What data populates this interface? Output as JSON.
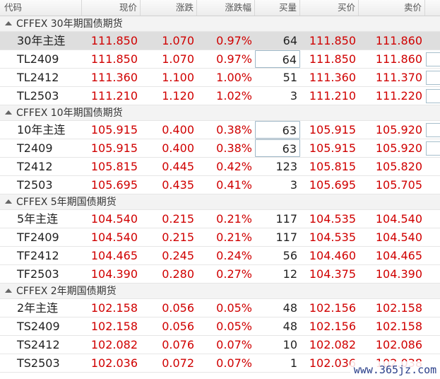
{
  "columns": [
    "代码",
    "现价",
    "涨跌",
    "涨跌幅",
    "买量",
    "买价",
    "卖价"
  ],
  "groups": [
    {
      "label": "CFFEX 30年期国债期货",
      "rows": [
        {
          "code": "30年主连",
          "price": "111.850",
          "change": "1.070",
          "pct": "0.97%",
          "bid_vol": "64",
          "bid": "111.850",
          "ask": "111.860",
          "selected": true
        },
        {
          "code": "TL2409",
          "price": "111.850",
          "change": "1.070",
          "pct": "0.97%",
          "bid_vol": "64",
          "bid": "111.850",
          "ask": "111.860",
          "bidvol_box": true,
          "edge_box": true
        },
        {
          "code": "TL2412",
          "price": "111.360",
          "change": "1.100",
          "pct": "1.00%",
          "bid_vol": "51",
          "bid": "111.360",
          "ask": "111.370",
          "edge_box": true
        },
        {
          "code": "TL2503",
          "price": "111.210",
          "change": "1.120",
          "pct": "1.02%",
          "bid_vol": "3",
          "bid": "111.210",
          "ask": "111.220",
          "edge_box": true
        }
      ]
    },
    {
      "label": "CFFEX 10年期国债期货",
      "rows": [
        {
          "code": "10年主连",
          "price": "105.915",
          "change": "0.400",
          "pct": "0.38%",
          "bid_vol": "63",
          "bid": "105.915",
          "ask": "105.920",
          "bidvol_box": true,
          "edge_box": true
        },
        {
          "code": "T2409",
          "price": "105.915",
          "change": "0.400",
          "pct": "0.38%",
          "bid_vol": "63",
          "bid": "105.915",
          "ask": "105.920",
          "bidvol_box": true,
          "edge_box": true
        },
        {
          "code": "T2412",
          "price": "105.815",
          "change": "0.445",
          "pct": "0.42%",
          "bid_vol": "123",
          "bid": "105.815",
          "ask": "105.820"
        },
        {
          "code": "T2503",
          "price": "105.695",
          "change": "0.435",
          "pct": "0.41%",
          "bid_vol": "3",
          "bid": "105.695",
          "ask": "105.705"
        }
      ]
    },
    {
      "label": "CFFEX 5年期国债期货",
      "rows": [
        {
          "code": "5年主连",
          "price": "104.540",
          "change": "0.215",
          "pct": "0.21%",
          "bid_vol": "117",
          "bid": "104.535",
          "ask": "104.540"
        },
        {
          "code": "TF2409",
          "price": "104.540",
          "change": "0.215",
          "pct": "0.21%",
          "bid_vol": "117",
          "bid": "104.535",
          "ask": "104.540"
        },
        {
          "code": "TF2412",
          "price": "104.465",
          "change": "0.245",
          "pct": "0.24%",
          "bid_vol": "56",
          "bid": "104.460",
          "ask": "104.465"
        },
        {
          "code": "TF2503",
          "price": "104.390",
          "change": "0.280",
          "pct": "0.27%",
          "bid_vol": "12",
          "bid": "104.375",
          "ask": "104.390"
        }
      ]
    },
    {
      "label": "CFFEX 2年期国债期货",
      "rows": [
        {
          "code": "2年主连",
          "price": "102.158",
          "change": "0.056",
          "pct": "0.05%",
          "bid_vol": "48",
          "bid": "102.156",
          "ask": "102.158"
        },
        {
          "code": "TS2409",
          "price": "102.158",
          "change": "0.056",
          "pct": "0.05%",
          "bid_vol": "48",
          "bid": "102.156",
          "ask": "102.158"
        },
        {
          "code": "TS2412",
          "price": "102.082",
          "change": "0.076",
          "pct": "0.07%",
          "bid_vol": "10",
          "bid": "102.082",
          "ask": "102.086"
        },
        {
          "code": "TS2503",
          "price": "102.036",
          "change": "0.072",
          "pct": "0.07%",
          "bid_vol": "1",
          "bid": "102.036",
          "ask": "102.038"
        }
      ]
    }
  ],
  "watermark": "www.365jz.com",
  "colors": {
    "up": "#d00000",
    "neutral": "#222222",
    "selected_row": "#dedede"
  }
}
